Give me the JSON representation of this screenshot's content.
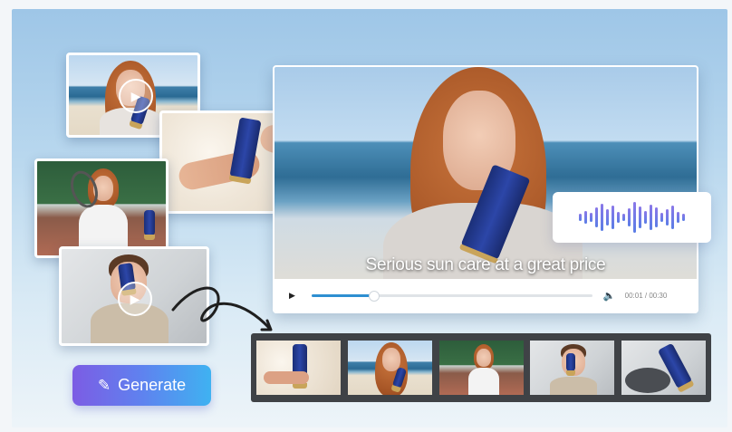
{
  "video": {
    "subtitle": "Serious sun care at a great price",
    "time": "00:01 / 00:30",
    "progress": 0.22,
    "play_icon": "play-icon",
    "volume_icon": "volume-icon"
  },
  "generate": {
    "label": "Generate",
    "icon": "magic-wand-icon"
  },
  "waveform": {
    "bars": [
      8,
      14,
      10,
      22,
      30,
      18,
      26,
      12,
      8,
      20,
      34,
      24,
      14,
      28,
      22,
      10,
      18,
      26,
      12,
      8
    ]
  },
  "colors": {
    "accent_start": "#7c5ce4",
    "accent_end": "#3fb2f1",
    "progress": "#2e8fd1",
    "strip_bg": "#3f4246"
  },
  "clips": [
    "beach-woman",
    "hand-sand",
    "tennis-woman",
    "studio-man"
  ],
  "timeline": [
    "hand-sand",
    "beach-woman",
    "tennis-woman",
    "studio-man",
    "product"
  ]
}
